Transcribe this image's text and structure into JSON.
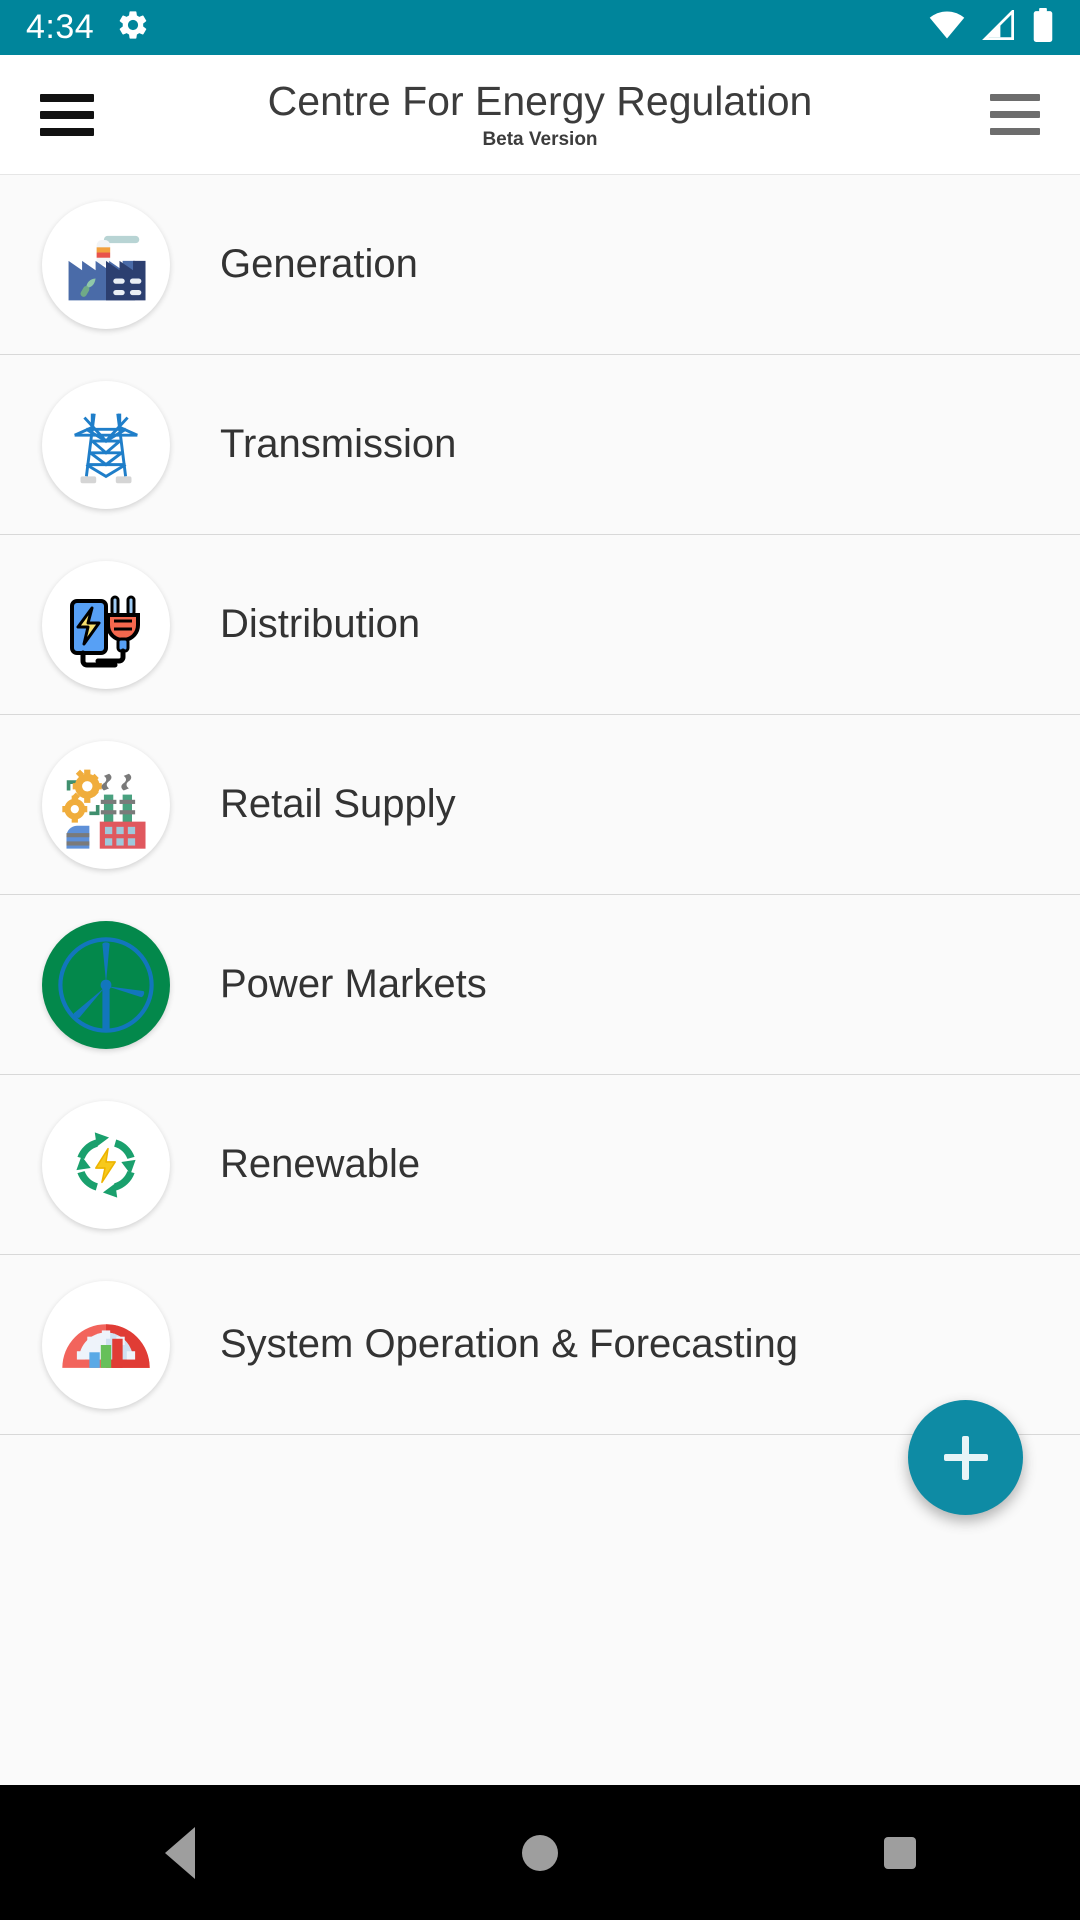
{
  "status_bar": {
    "time": "4:34",
    "icons": [
      "gear-icon",
      "wifi-icon",
      "cellular-signal-icon",
      "battery-icon"
    ],
    "background": "#00859b"
  },
  "app_bar": {
    "menu_icon": "hamburger-menu-icon",
    "title": "Centre For Energy Regulation",
    "subtitle": "Beta Version",
    "overflow_icon": "hamburger-menu-icon"
  },
  "list": {
    "items": [
      {
        "label": "Generation",
        "icon": "factory-icon"
      },
      {
        "label": "Transmission",
        "icon": "power-pylon-icon"
      },
      {
        "label": "Distribution",
        "icon": "plug-battery-icon"
      },
      {
        "label": "Retail Supply",
        "icon": "industry-gears-icon"
      },
      {
        "label": "Power Markets",
        "icon": "wind-turbine-icon"
      },
      {
        "label": "Renewable",
        "icon": "recycle-energy-icon"
      },
      {
        "label": "System Operation & Forecasting",
        "icon": "gauge-chart-icon"
      }
    ]
  },
  "fab": {
    "icon": "plus-icon",
    "label": "+",
    "color": "#0e8ba4"
  },
  "nav_bar": {
    "back": "back-triangle-icon",
    "home": "home-circle-icon",
    "recents": "recents-square-icon"
  },
  "colors": {
    "accent": "#00859b",
    "fab": "#0e8ba4",
    "page_background": "#fafafa",
    "text": "#333333"
  }
}
